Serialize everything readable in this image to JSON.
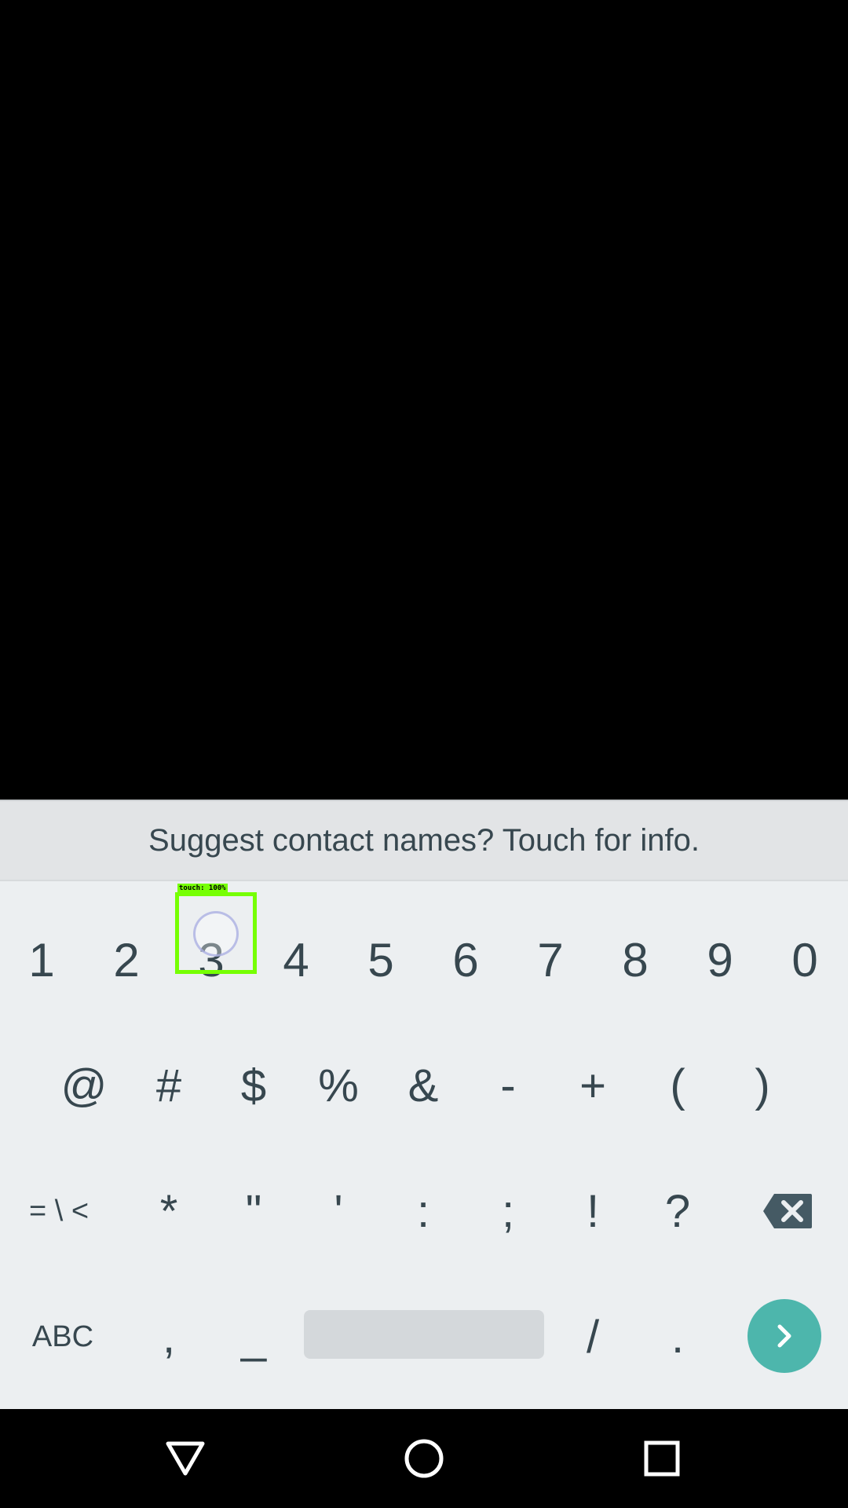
{
  "suggestion_bar": {
    "text": "Suggest contact names? Touch for info."
  },
  "keyboard": {
    "row1": [
      "1",
      "2",
      "3",
      "4",
      "5",
      "6",
      "7",
      "8",
      "9",
      "0"
    ],
    "row2": [
      "@",
      "#",
      "$",
      "%",
      "&",
      "-",
      "+",
      "(",
      ")"
    ],
    "row3": [
      "= \\ <",
      "*",
      "\"",
      "'",
      ":",
      ";",
      "!",
      "?"
    ],
    "row4": {
      "abc_label": "ABC",
      "comma": ",",
      "underscore": "_",
      "slash": "/",
      "period": "."
    },
    "icons": {
      "delete": "backspace-icon",
      "enter": "chevron-right-icon"
    },
    "colors": {
      "background": "#eceff1",
      "key_text": "#37474f",
      "enter_accent": "#4db6ac",
      "space_key": "#d4d8db"
    }
  },
  "touch_overlay": {
    "label": "touch: 100%",
    "color": "#76ff03"
  },
  "nav_bar": {
    "icons": [
      "back-triangle-icon",
      "home-circle-icon",
      "recents-square-icon"
    ]
  }
}
